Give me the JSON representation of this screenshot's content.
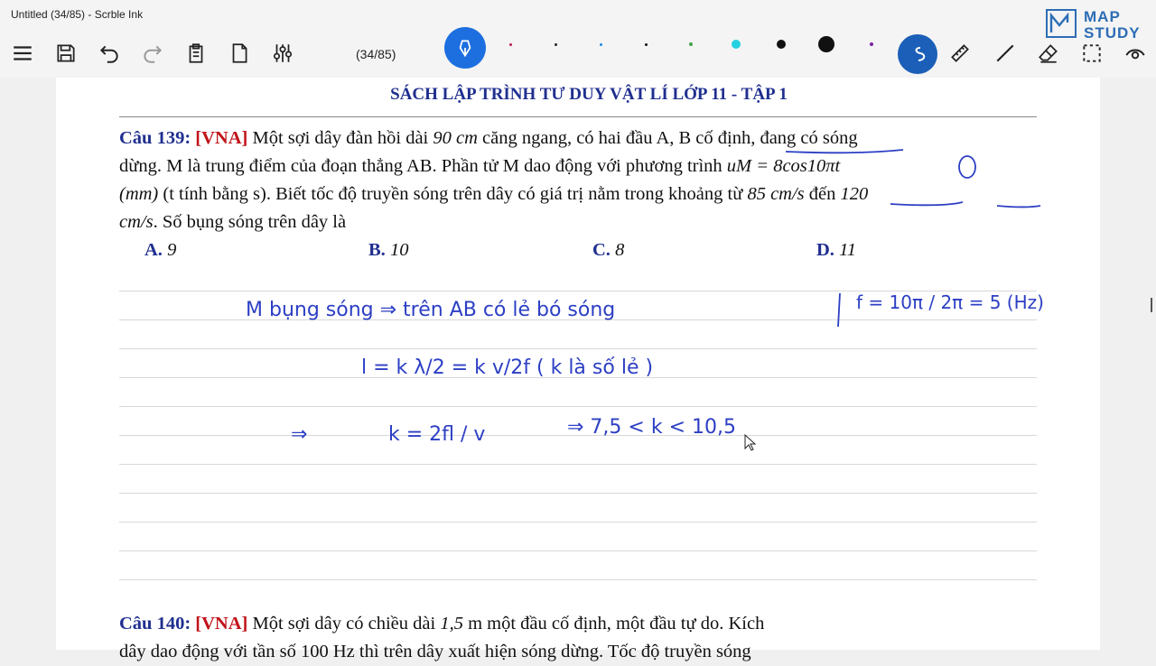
{
  "window": {
    "title": "Untitled (34/85) - Scrble Ink"
  },
  "toolbar": {
    "page_counter": "(34/85)",
    "brand_top": "MAP",
    "brand_bottom": "STUDY",
    "pen_colors": [
      "#c2185b",
      "#222222",
      "#1e88e5",
      "#111111",
      "#43a047",
      "#26d0e0",
      "#111111",
      "#111111",
      "#7b1fa2"
    ]
  },
  "document": {
    "book_title": "SÁCH LẬP TRÌNH TƯ DUY VẬT LÍ LỚP 11 - TẬP 1",
    "q139": {
      "num": "Câu 139:",
      "tag": "[VNA]",
      "line1_a": " Một sợi dây đàn hồi dài ",
      "line1_b": "90 cm",
      "line1_c": " căng ngang, có hai đầu A, B cố định, đang có sóng",
      "line2": "dừng. M là trung điểm của đoạn thẳng AB. Phần tử M dao động với phương trình ",
      "line2_eq": "uM = 8cos10πt",
      "line3_a": "(mm)",
      "line3_b": " (t tính bằng s). Biết tốc độ truyền sóng trên dây có giá trị nằm trong khoảng từ ",
      "line3_c": "85 cm/s",
      "line3_d": " đến ",
      "line3_e": "120",
      "line4_a": "cm/s",
      "line4_b": ". Số bụng sóng trên dây là"
    },
    "answers": [
      {
        "letter": "A.",
        "value": "9"
      },
      {
        "letter": "B.",
        "value": "10"
      },
      {
        "letter": "C.",
        "value": "8"
      },
      {
        "letter": "D.",
        "value": "11"
      }
    ],
    "q140": {
      "num": "Câu 140:",
      "tag": "[VNA]",
      "line1_a": " Một sợi dây có chiều dài ",
      "line1_b": "1,5",
      "line1_c": " m một đầu cố định, một đầu tự do. Kích",
      "line2": "dây dao động với tần số 100 Hz thì trên dây xuất hiện sóng dừng. Tốc độ truyền sóng"
    }
  },
  "handwriting": {
    "line1": "M   bụng sóng   ⇒   trên AB có lẻ bó sóng",
    "freq": "f = 10π / 2π = 5 (Hz)",
    "line2": "l = k λ/2 = k v/2f  ( k là số lẻ )",
    "line3_arrow": "⇒",
    "line3": "k = 2fl / v",
    "line3_b": "⇒  7,5 < k < 10,5"
  }
}
